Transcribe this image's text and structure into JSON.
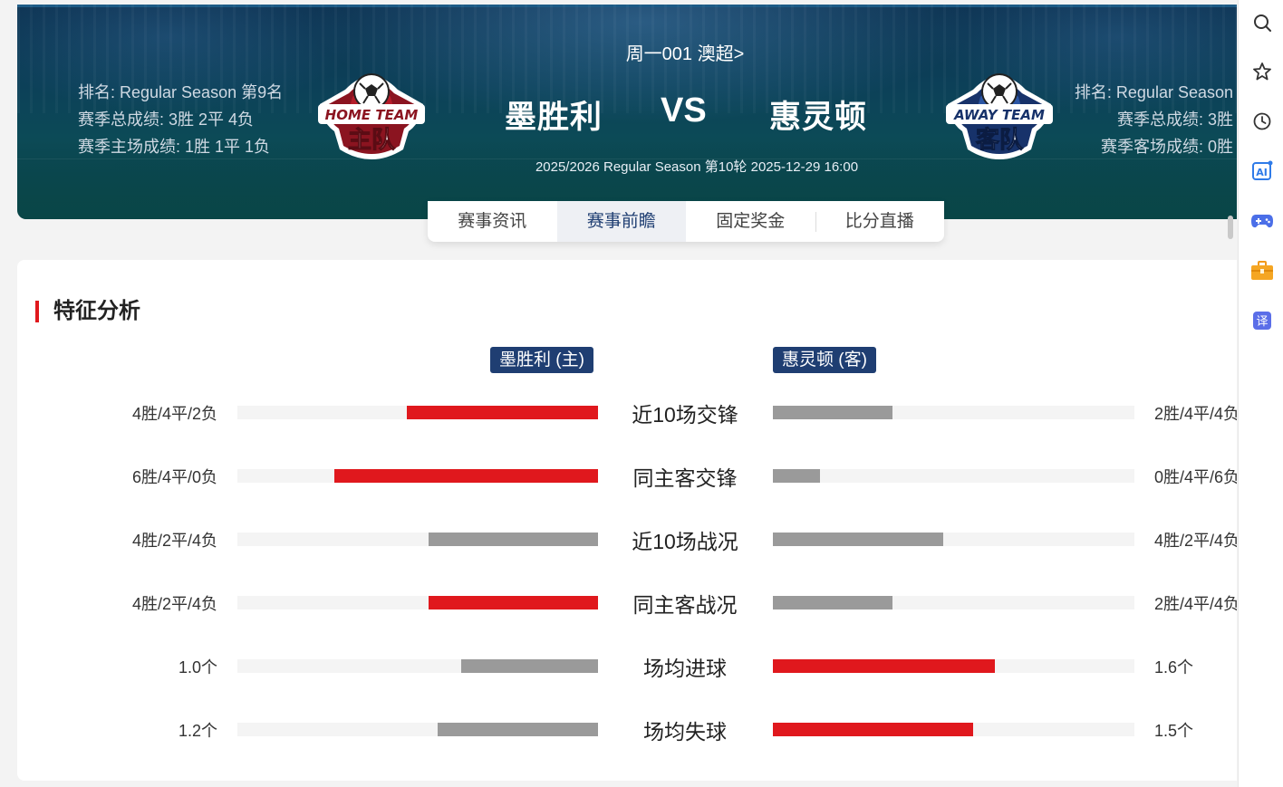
{
  "hero": {
    "league_line": "周一001 澳超>",
    "home_team": "墨胜利",
    "away_team": "惠灵顿",
    "vs": "VS",
    "match_info": "2025/2026 Regular Season 第10轮 2025-12-29 16:00",
    "home_stats": {
      "rank": "排名: Regular Season 第9名",
      "season_total": "赛季总成绩: 3胜 2平 4负",
      "season_home": "赛季主场成绩: 1胜 1平 1负"
    },
    "away_stats": {
      "rank": "排名: Regular Season",
      "season_total": "赛季总成绩: 3胜",
      "season_away": "赛季客场成绩: 0胜"
    },
    "home_badge": {
      "top": "HOME TEAM",
      "bottom": "主队"
    },
    "away_badge": {
      "top": "AWAY TEAM",
      "bottom": "客队"
    }
  },
  "tabs": [
    {
      "label": "赛事资讯",
      "active": false
    },
    {
      "label": "赛事前瞻",
      "active": true
    },
    {
      "label": "固定奖金",
      "active": false
    },
    {
      "label": "比分直播",
      "active": false
    }
  ],
  "analysis": {
    "title": "特征分析",
    "home_tag": "墨胜利 (主)",
    "away_tag": "惠灵顿 (客)",
    "colors": {
      "highlight": "#e0181d",
      "neutral": "#9a9a9a",
      "track": "#f4f4f4"
    },
    "rows": [
      {
        "label": "近10场交锋",
        "home_value": "4胜/4平/2负",
        "home_pct": 0.53,
        "home_color": "red",
        "away_value": "2胜/4平/4负",
        "away_pct": 0.33,
        "away_color": "gray"
      },
      {
        "label": "同主客交锋",
        "home_value": "6胜/4平/0负",
        "home_pct": 0.73,
        "home_color": "red",
        "away_value": "0胜/4平/6负",
        "away_pct": 0.13,
        "away_color": "gray"
      },
      {
        "label": "近10场战况",
        "home_value": "4胜/2平/4负",
        "home_pct": 0.47,
        "home_color": "gray",
        "away_value": "4胜/2平/4负",
        "away_pct": 0.47,
        "away_color": "gray"
      },
      {
        "label": "同主客战况",
        "home_value": "4胜/2平/4负",
        "home_pct": 0.47,
        "home_color": "red",
        "away_value": "2胜/4平/4负",
        "away_pct": 0.33,
        "away_color": "gray"
      },
      {
        "label": "场均进球",
        "home_value": "1.0个",
        "home_pct": 0.38,
        "home_color": "gray",
        "away_value": "1.6个",
        "away_pct": 0.615,
        "away_color": "red"
      },
      {
        "label": "场均失球",
        "home_value": "1.2个",
        "home_pct": 0.445,
        "home_color": "gray",
        "away_value": "1.5个",
        "away_pct": 0.555,
        "away_color": "red"
      }
    ]
  },
  "sidebar": {
    "items": [
      {
        "icon": "search-icon"
      },
      {
        "icon": "star-icon"
      },
      {
        "icon": "history-icon"
      },
      {
        "icon": "ai-icon",
        "text": "AI"
      },
      {
        "icon": "gamepad-icon"
      },
      {
        "icon": "toolbox-icon"
      },
      {
        "icon": "translate-icon",
        "text": "译"
      }
    ]
  }
}
